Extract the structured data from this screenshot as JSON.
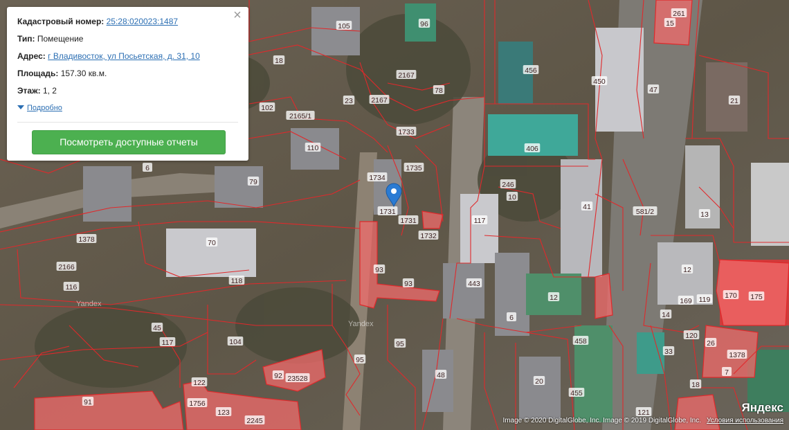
{
  "panel": {
    "cadastral_label": "Кадастровый номер:",
    "cadastral_value": "25:28:020023:1487",
    "type_label": "Тип:",
    "type_value": "Помещение",
    "address_label": "Адрес:",
    "address_value": "г Владивосток, ул Посьетская, д. 31, 10",
    "area_label": "Площадь:",
    "area_value": "157.30 кв.м.",
    "floor_label": "Этаж:",
    "floor_value": "1, 2",
    "details_link": "Подробно",
    "reports_button": "Посмотреть доступные отчеты",
    "close_icon": "close-icon"
  },
  "map": {
    "marker_icon": "location-pin-icon",
    "parcel_color": "#e0292b",
    "parcel_fill_color": "#f26b6b",
    "parcel_labels": [
      "261",
      "15",
      "96",
      "105",
      "18",
      "456",
      "450",
      "47",
      "21",
      "102",
      "2165/1",
      "2167",
      "78",
      "23",
      "2167",
      "1733",
      "110",
      "406",
      "1735",
      "6",
      "1734",
      "79",
      "246",
      "10",
      "41",
      "1731",
      "1731",
      "1732",
      "117",
      "581/2",
      "13",
      "1378",
      "70",
      "2166",
      "116",
      "118",
      "93",
      "93",
      "443",
      "12",
      "12",
      "169",
      "119",
      "170",
      "175",
      "14",
      "120",
      "26",
      "1378",
      "6",
      "458",
      "33",
      "45",
      "117",
      "104",
      "95",
      "95",
      "20",
      "48",
      "455",
      "92",
      "23528",
      "122",
      "1756",
      "123",
      "2245",
      "91",
      "7",
      "18",
      "121"
    ]
  },
  "watermarks": [
    "Yandex",
    "Yandex"
  ],
  "copyright": {
    "text": "Image © 2020 DigitalGlobe, Inc. Image © 2019 DigitalGlobe, Inc.",
    "terms": "Условия использования",
    "logo": "Яндекс"
  }
}
